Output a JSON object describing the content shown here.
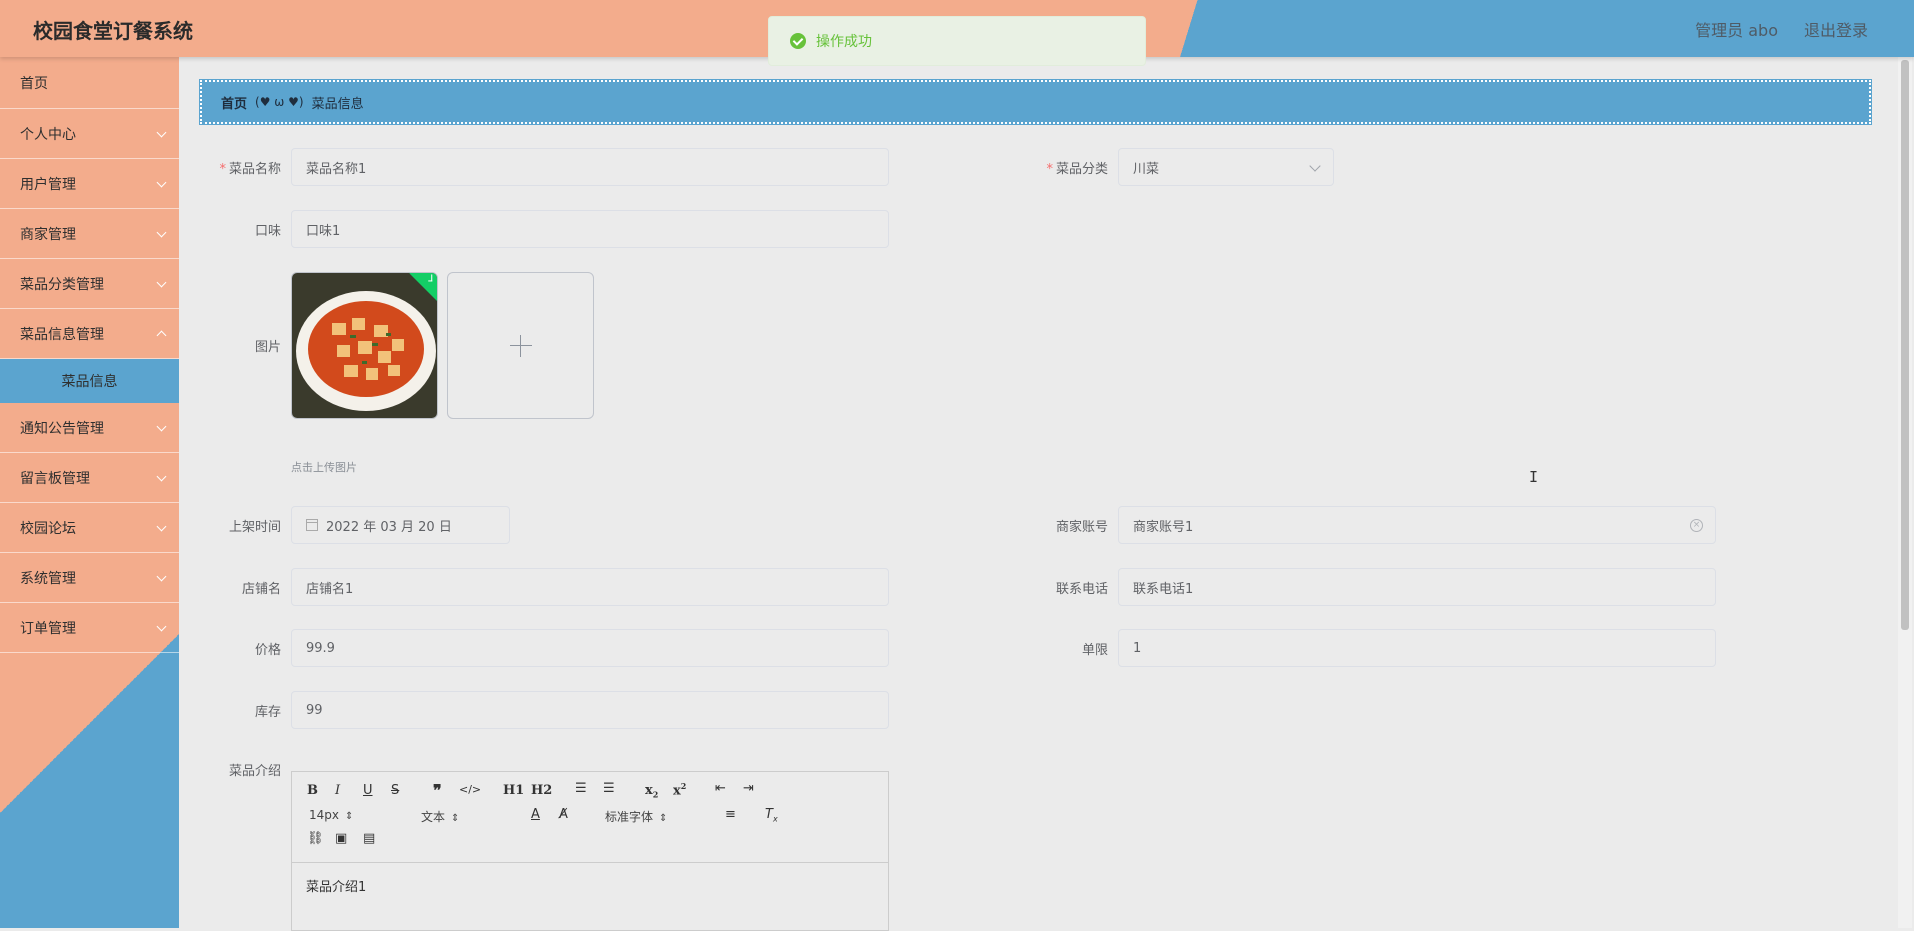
{
  "header": {
    "app_title": "校园食堂订餐系统",
    "user_label": "管理员 abo",
    "logout_label": "退出登录"
  },
  "toast": {
    "message": "操作成功",
    "color": "#67c23a"
  },
  "sidebar": {
    "items": [
      {
        "label": "首页"
      },
      {
        "label": "个人中心"
      },
      {
        "label": "用户管理"
      },
      {
        "label": "商家管理"
      },
      {
        "label": "菜品分类管理"
      },
      {
        "label": "菜品信息管理"
      },
      {
        "label": "菜品信息"
      },
      {
        "label": "通知公告管理"
      },
      {
        "label": "留言板管理"
      },
      {
        "label": "校园论坛"
      },
      {
        "label": "系统管理"
      },
      {
        "label": "订单管理"
      }
    ]
  },
  "breadcrumb": {
    "home": "首页",
    "separator": "(♥ ω ♥)",
    "current": "菜品信息"
  },
  "form": {
    "dish_name_label": "菜品名称",
    "dish_name_value": "菜品名称1",
    "category_label": "菜品分类",
    "category_value": "川菜",
    "taste_label": "口味",
    "taste_value": "口味1",
    "image_label": "图片",
    "upload_tip": "点击上传图片",
    "shelf_time_label": "上架时间",
    "shelf_time_value": "2022 年 03 月 20 日",
    "merchant_account_label": "商家账号",
    "merchant_account_value": "商家账号1",
    "shop_name_label": "店铺名",
    "shop_name_value": "店铺名1",
    "phone_label": "联系电话",
    "phone_value": "联系电话1",
    "price_label": "价格",
    "price_value": "99.9",
    "limit_label": "单限",
    "limit_value": "1",
    "stock_label": "库存",
    "stock_value": "99",
    "intro_label": "菜品介绍",
    "intro_value": "菜品介绍1"
  },
  "editor": {
    "font_size": "14px",
    "block_type": "文本",
    "font_family": "标准字体",
    "h1": "H1",
    "h2": "H2"
  },
  "colors": {
    "header_orange": "#f3ac8c",
    "header_blue": "#5ba4cf",
    "required": "#f56c6c"
  }
}
